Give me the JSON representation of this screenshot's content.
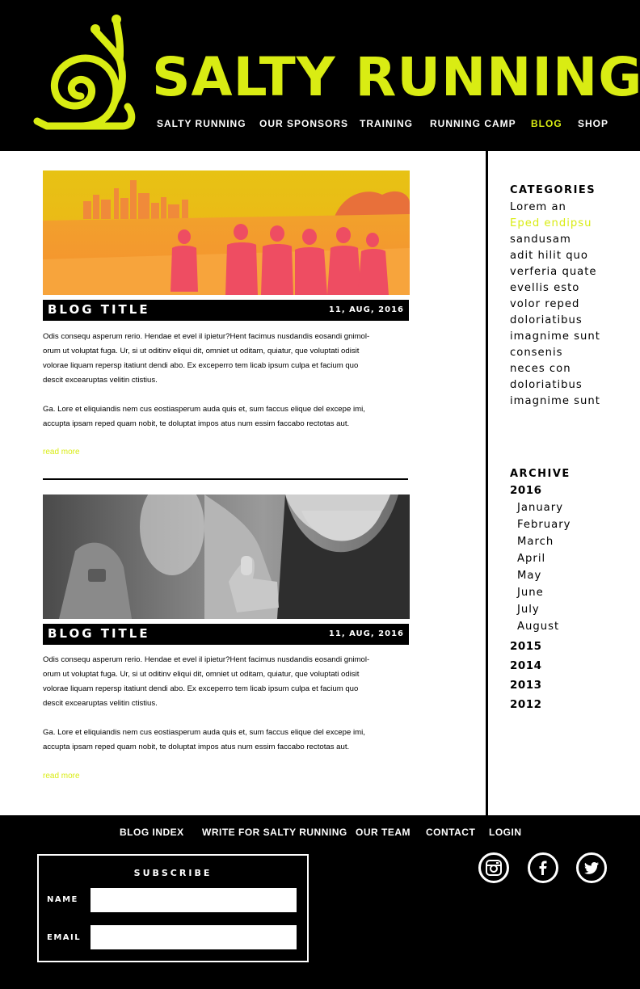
{
  "brand": {
    "name": "SALTY RUNNING",
    "accent_color": "#d9ec13",
    "logo_icon": "snail-icon"
  },
  "nav": {
    "items": [
      {
        "label": "SALTY RUNNING"
      },
      {
        "label": "OUR SPONSORS"
      },
      {
        "label": "TRAINING"
      },
      {
        "label": "RUNNING CAMP"
      },
      {
        "label": "BLOG",
        "active": true
      },
      {
        "label": "SHOP"
      }
    ]
  },
  "posts": [
    {
      "title": "BLOG TITLE",
      "date": "11, AUG, 2016",
      "image_desc": "orange-tinted runners by the lake with city skyline",
      "lines1": [
        "Odis consequ asperum rerio. Hendae et evel il ipietur?Hent facimus nusdandis eosandi gnimol-",
        "orum ut voluptat fuga. Ur, si ut oditinv eliqui dit, omniet ut oditam, quiatur, que voluptati odisit",
        "volorae liquam repersp itatiunt dendi abo. Ex exceperro tem licab ipsum culpa et facium quo",
        "descit excearuptas velitin ctistius."
      ],
      "lines2": [
        "Ga. Lore et eliquiandis nem cus eostiasperum auda quis et, sum faccus elique del excepe imi,",
        "accupta ipsam reped quam nobit, te doluptat impos atus num essim faccabo rectotas aut."
      ],
      "read_more": "read more"
    },
    {
      "title": "BLOG TITLE",
      "date": "11, AUG, 2016",
      "image_desc": "grayscale runner giving a thumbs up",
      "lines1": [
        "Odis consequ asperum rerio. Hendae et evel il ipietur?Hent facimus nusdandis eosandi gnimol-",
        "orum ut voluptat fuga. Ur, si ut oditinv eliqui dit, omniet ut oditam, quiatur, que voluptati odisit",
        "volorae liquam repersp itatiunt dendi abo. Ex exceperro tem licab ipsum culpa et facium quo",
        "descit excearuptas velitin ctistius."
      ],
      "lines2": [
        "Ga. Lore et eliquiandis nem cus eostiasperum auda quis et, sum faccus elique del excepe imi,",
        "accupta ipsam reped quam nobit, te doluptat impos atus num essim faccabo rectotas aut."
      ],
      "read_more": "read more"
    }
  ],
  "sidebar": {
    "categories_heading": "CATEGORIES",
    "categories": [
      "Lorem an",
      "Eped endipsu",
      "sandusam",
      "adit hilit quo",
      "verferia quate",
      "evellis esto",
      "volor reped",
      "doloriatibus",
      "imagnime sunt",
      "consenis",
      "neces con",
      "doloriatibus",
      "imagnime sunt"
    ],
    "active_category_index": 1,
    "archive_heading": "ARCHIVE",
    "years": [
      "2016",
      "2015",
      "2014",
      "2013",
      "2012"
    ],
    "months_2016": [
      "January",
      "February",
      "March",
      "April",
      "May",
      "June",
      "July",
      "August"
    ]
  },
  "footer": {
    "links": [
      "BLOG INDEX",
      "WRITE FOR SALTY RUNNING",
      "OUR TEAM",
      "CONTACT",
      "LOGIN"
    ],
    "subscribe": {
      "title": "SUBSCRIBE",
      "name_label": "NAME",
      "email_label": "EMAIL",
      "name_value": "",
      "email_value": ""
    },
    "social": [
      "instagram-icon",
      "facebook-icon",
      "twitter-icon"
    ]
  }
}
